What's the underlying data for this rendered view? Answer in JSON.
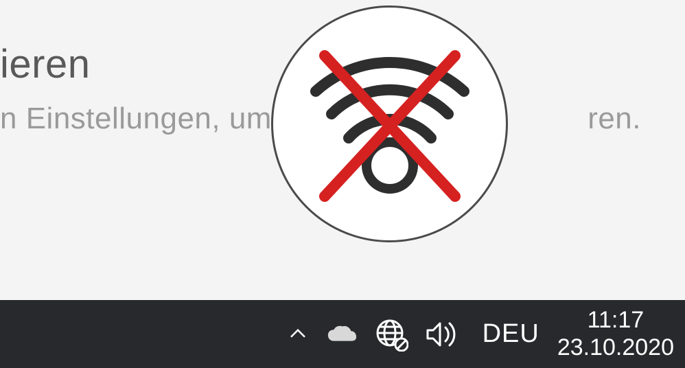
{
  "content": {
    "heading_fragment": "ieren",
    "body_fragment_left": "n Einstellungen, um W",
    "body_fragment_right": "ren."
  },
  "overlay": {
    "icon_name": "wifi-disabled-icon"
  },
  "taskbar": {
    "language": "DEU",
    "time": "11:17",
    "date": "23.10.2020",
    "icons": {
      "chevron": "chevron-up-icon",
      "onedrive": "onedrive-icon",
      "network": "network-disabled-icon",
      "sound": "sound-icon"
    }
  }
}
